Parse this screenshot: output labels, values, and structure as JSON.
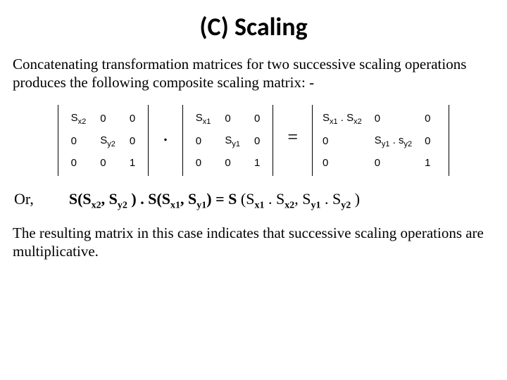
{
  "title": "(C) Scaling",
  "intro": "Concatenating transformation matrices for two successive scaling operations produces the following composite scaling matrix: -",
  "m1": {
    "r0c0_main": "S",
    "r0c0_sub": "x2",
    "r0c1": "0",
    "r0c2": "0",
    "r1c0": "0",
    "r1c1_main": "S",
    "r1c1_sub": "y2",
    "r1c2": "0",
    "r2c0": "0",
    "r2c1": "0",
    "r2c2": "1"
  },
  "op_dot": ".",
  "m2": {
    "r0c0_main": "S",
    "r0c0_sub": "x1",
    "r0c1": "0",
    "r0c2": "0",
    "r1c0": "0",
    "r1c1_main": "S",
    "r1c1_sub": "y1",
    "r1c2": "0",
    "r2c0": "0",
    "r2c1": "0",
    "r2c2": "1"
  },
  "op_eq": "=",
  "m3": {
    "r0c0_a_main": "S",
    "r0c0_a_sub": "x1",
    "r0c0_dot": " . ",
    "r0c0_b_main": "S",
    "r0c0_b_sub": "x2",
    "r0c1": "0",
    "r0c2": "0",
    "r1c0": "0",
    "r1c1_a_main": "S",
    "r1c1_a_sub": "y1",
    "r1c1_dot": " . ",
    "r1c1_b_main": "s",
    "r1c1_b_sub": "y2",
    "r1c2": "0",
    "r2c0": "0",
    "r2c1": "0",
    "r2c2": "1"
  },
  "or_label": "Or,",
  "Seq": {
    "p1": "S(S",
    "s1": "x2",
    "p2": ", S",
    "s2": "y2",
    "p3": " ) . S(S",
    "s3": "x1",
    "p4": ", S",
    "s4": "y1",
    "p5": ") =  S ",
    "p5b": "(S",
    "s5": "x1",
    "p6": " . S",
    "s6": "x2",
    "p7": ", S",
    "s7": "y1",
    "p8": " . S",
    "s8": "y2",
    "p9": " )"
  },
  "outro": "The resulting matrix in this case indicates that successive scaling operations are multiplicative."
}
